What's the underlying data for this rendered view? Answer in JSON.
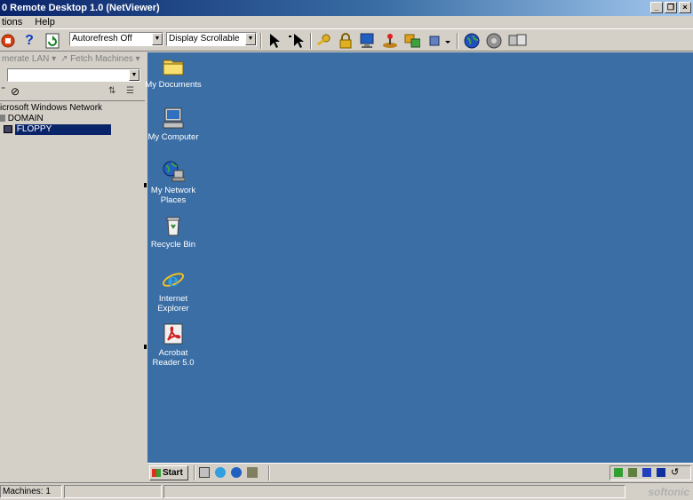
{
  "window": {
    "title": "0 Remote Desktop 1.0 (NetViewer)",
    "controls": {
      "minimize": "_",
      "restore": "❐",
      "close": "×"
    }
  },
  "menu": {
    "items": [
      "tions",
      "Help"
    ]
  },
  "toolbar": {
    "autorefresh_value": "Autorefresh Off",
    "display_value": "Display Scrollable",
    "icons": [
      "stop-icon",
      "help-icon",
      "refresh-icon",
      "pointer-icon",
      "remote-pointer-icon",
      "key-icon",
      "lock-icon",
      "monitor-icon",
      "joystick-icon",
      "transfer-icon",
      "config-icon",
      "globe-icon",
      "disc-icon",
      "screens-icon"
    ]
  },
  "left_panel": {
    "enumerate_label": "merate LAN",
    "fetch_label": "Fetch Machines",
    "combo_value": "",
    "tree": {
      "root": "icrosoft Windows Network",
      "domain": "DOMAIN",
      "machine": "FLOPPY"
    }
  },
  "desktop": {
    "icons": [
      {
        "label": "My Documents",
        "icon": "folder-icon"
      },
      {
        "label": "My Computer",
        "icon": "computer-icon"
      },
      {
        "label": "My Network Places",
        "icon": "network-icon"
      },
      {
        "label": "Recycle Bin",
        "icon": "recycle-bin-icon"
      },
      {
        "label": "Internet Explorer",
        "icon": "ie-icon"
      },
      {
        "label": "Acrobat Reader 5.0",
        "icon": "acrobat-icon"
      }
    ]
  },
  "taskbar": {
    "start_label": "Start"
  },
  "status": {
    "machines": "Machines: 1",
    "watermark": "softonic"
  },
  "colors": {
    "desktop": "#3a6ea5",
    "selection": "#0a246a",
    "chrome": "#d4d0c8"
  }
}
